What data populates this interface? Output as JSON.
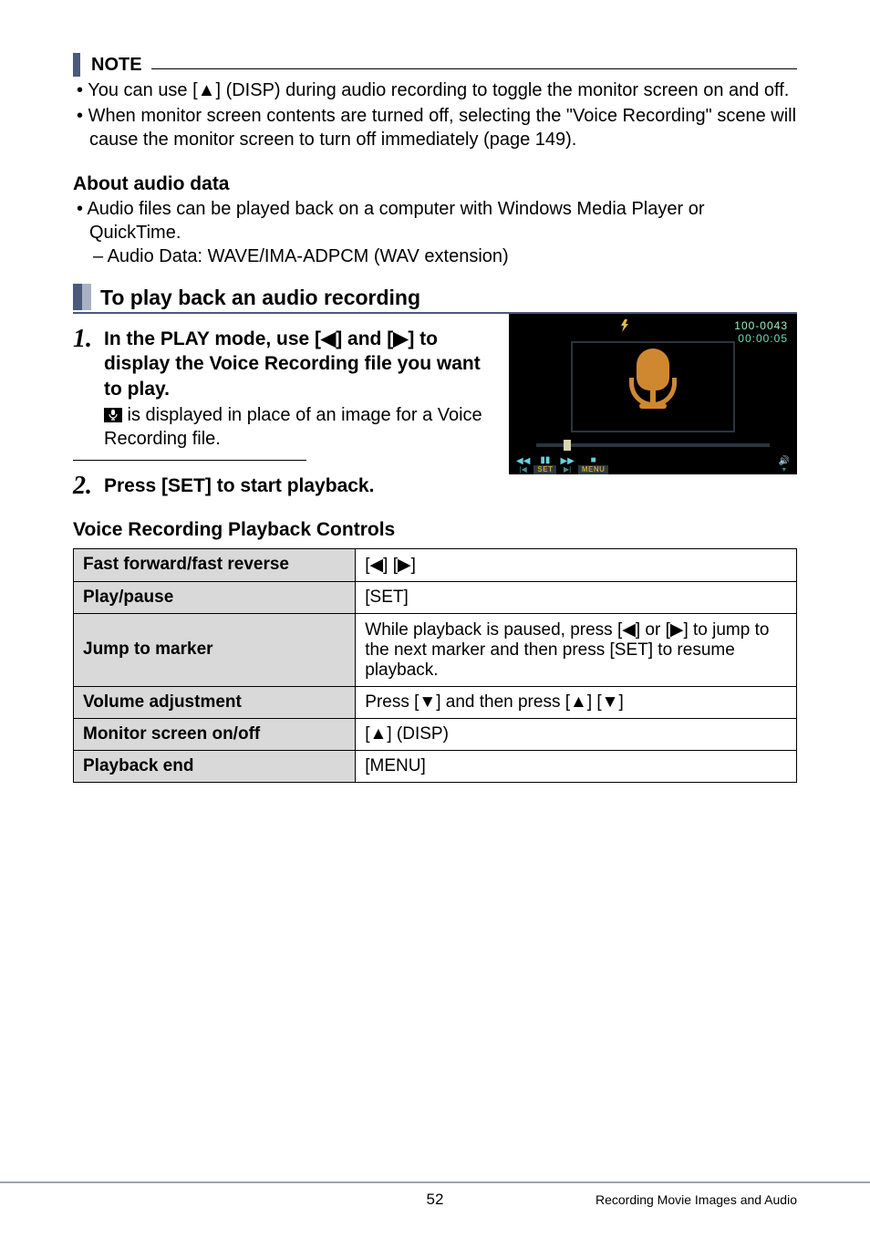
{
  "note": {
    "label": "NOTE",
    "bullets": [
      "You can use [▲] (DISP) during audio recording to toggle the monitor screen on and off.",
      "When monitor screen contents are turned off, selecting the \"Voice Recording\" scene will cause the monitor screen to turn off immediately (page 149)."
    ]
  },
  "about": {
    "heading": "About audio data",
    "bullet": "Audio files can be played back on a computer with Windows Media Player or QuickTime.",
    "dash": "Audio Data: WAVE/IMA-ADPCM (WAV extension)"
  },
  "section_title": "To play back an audio recording",
  "step1": {
    "num": "1.",
    "bold": "In the PLAY mode, use [◀] and [▶] to display the Voice Recording file you want to play.",
    "desc_suffix": " is displayed in place of an image for a Voice Recording file."
  },
  "step2": {
    "num": "2.",
    "bold": "Press [SET] to start playback."
  },
  "camera": {
    "file_no": "100-0043",
    "time": "00:00:05",
    "btn_set": "SET",
    "btn_menu": "MENU"
  },
  "table": {
    "title": "Voice Recording Playback Controls",
    "rows": [
      {
        "label": "Fast forward/fast reverse",
        "value": "[◀] [▶]"
      },
      {
        "label": "Play/pause",
        "value": "[SET]"
      },
      {
        "label": "Jump to marker",
        "value": "While playback is paused, press [◀] or [▶] to jump to the next marker and then press [SET] to resume playback."
      },
      {
        "label": "Volume adjustment",
        "value": "Press [▼] and then press [▲] [▼]"
      },
      {
        "label": "Monitor screen on/off",
        "value": "[▲] (DISP)"
      },
      {
        "label": "Playback end",
        "value": "[MENU]"
      }
    ]
  },
  "footer": {
    "page": "52",
    "section": "Recording Movie Images and Audio"
  }
}
